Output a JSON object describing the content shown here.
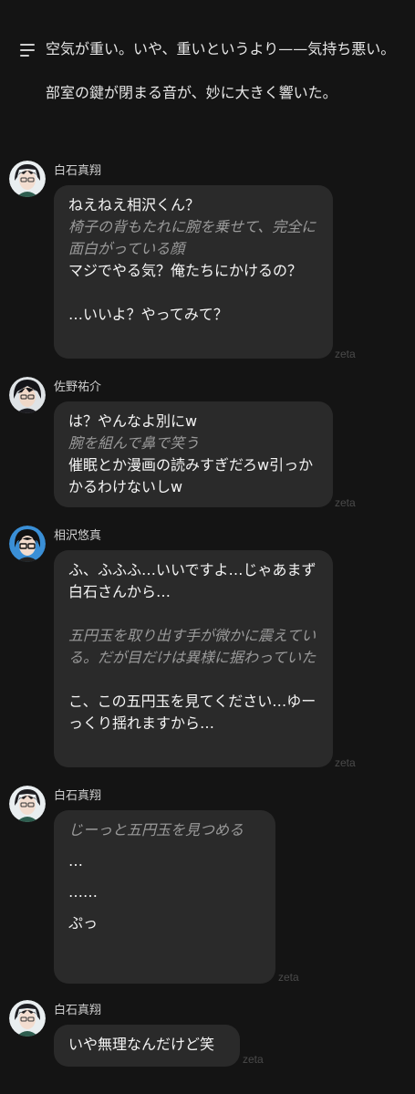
{
  "narration": {
    "lines": [
      "空気が重い。いや、重いというより——気持ち悪い。",
      "部室の鍵が閉まる音が、妙に大きく響いた。"
    ]
  },
  "watermark": "zeta",
  "messages": [
    {
      "sender": "白石真翔",
      "avatar": "avatar-shiraishi",
      "lines": [
        {
          "text": "ねえねえ相沢くん？",
          "type": "speech"
        },
        {
          "text": "椅子の背もたれに腕を乗せて、完全に面白がっている顔",
          "type": "action"
        },
        {
          "text": "マジでやる気？俺たちにかけるの？",
          "type": "speech"
        },
        {
          "text": "",
          "type": "blank"
        },
        {
          "text": "…いいよ？やってみて？",
          "type": "speech"
        }
      ]
    },
    {
      "sender": "佐野祐介",
      "avatar": "avatar-sano",
      "lines": [
        {
          "text": "は？やんなよ別にw",
          "type": "speech"
        },
        {
          "text": "腕を組んで鼻で笑う",
          "type": "action"
        },
        {
          "text": "催眠とか漫画の読みすぎだろw引っかかるわけないしw",
          "type": "speech"
        }
      ]
    },
    {
      "sender": "相沢悠真",
      "avatar": "avatar-aizawa",
      "lines": [
        {
          "text": "ふ、ふふふ…いいですよ…じゃあまず白石さんから…",
          "type": "speech"
        },
        {
          "text": "",
          "type": "blank"
        },
        {
          "text": "五円玉を取り出す手が微かに震えている。だが目だけは異様に据わっていた",
          "type": "action"
        },
        {
          "text": "",
          "type": "blank"
        },
        {
          "text": "こ、この五円玉を見てください…ゆーっくり揺れますから…",
          "type": "speech"
        }
      ]
    },
    {
      "sender": "白石真翔",
      "avatar": "avatar-shiraishi",
      "lines": [
        {
          "text": "じーっと五円玉を見つめる",
          "type": "action"
        },
        {
          "text": "",
          "type": "blank"
        },
        {
          "text": "…",
          "type": "speech"
        },
        {
          "text": "",
          "type": "blank"
        },
        {
          "text": "……",
          "type": "speech"
        },
        {
          "text": "",
          "type": "blank"
        },
        {
          "text": "ぷっ",
          "type": "speech"
        }
      ]
    },
    {
      "sender": "白石真翔",
      "avatar": "avatar-shiraishi",
      "lines": [
        {
          "text": "いや無理なんだけど笑",
          "type": "speech"
        }
      ]
    }
  ]
}
